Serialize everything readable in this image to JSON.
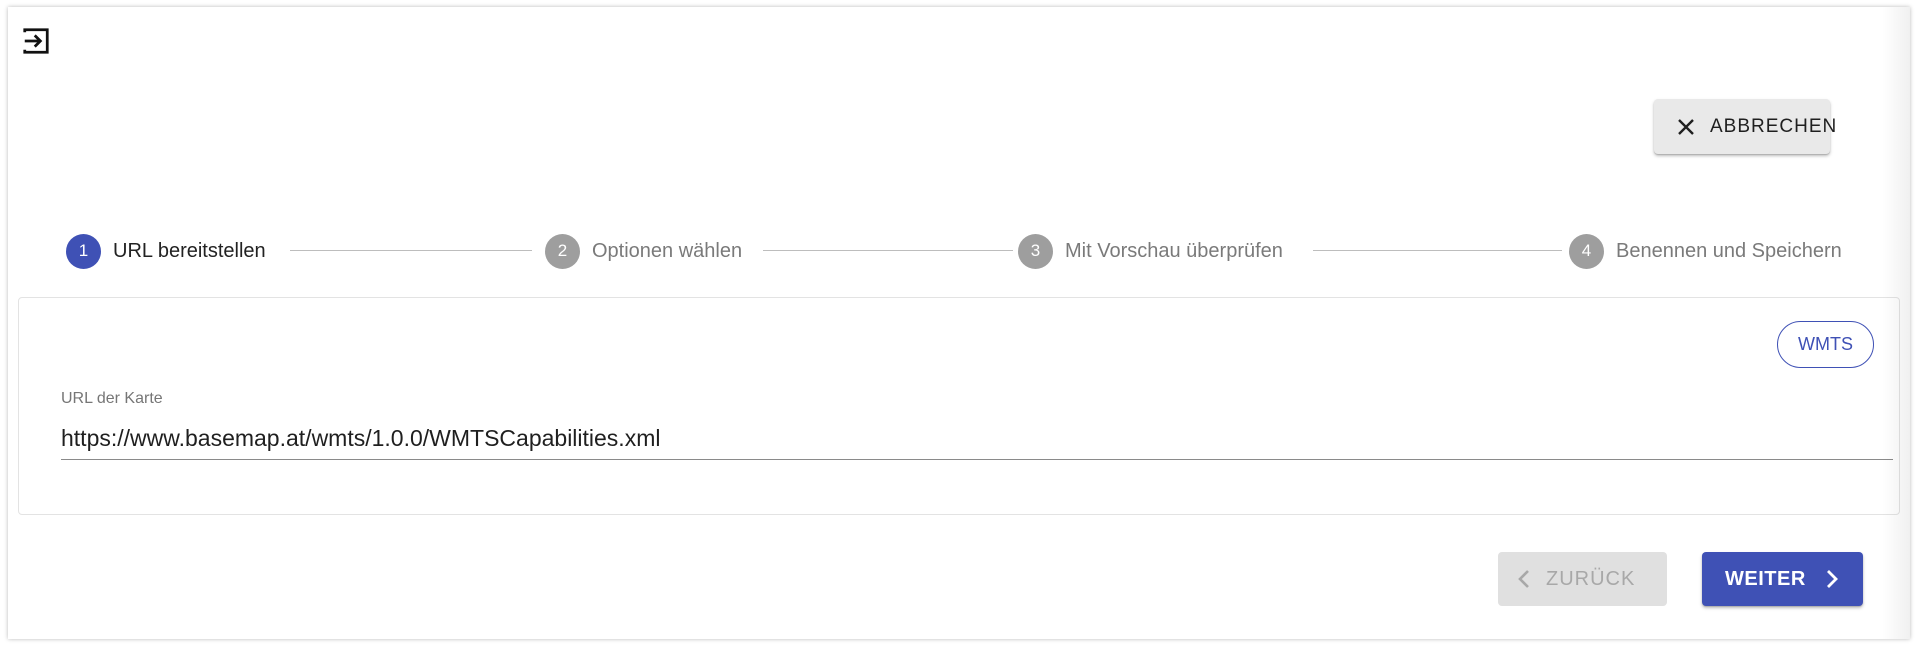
{
  "header": {
    "exit_icon": "exit-to-app-icon",
    "cancel_button": {
      "icon": "close-icon",
      "label": "ABBRECHEN"
    }
  },
  "stepper": {
    "active_step": 1,
    "steps": [
      {
        "number": "1",
        "label": "URL bereitstellen",
        "state": "active"
      },
      {
        "number": "2",
        "label": "Optionen wählen",
        "state": "inactive"
      },
      {
        "number": "3",
        "label": "Mit Vorschau überprüfen",
        "state": "inactive"
      },
      {
        "number": "4",
        "label": "Benennen und Speichern",
        "state": "inactive"
      }
    ]
  },
  "form": {
    "service_chip": "WMTS",
    "url_label": "URL der Karte",
    "url_value": "https://www.basemap.at/wmts/1.0.0/WMTSCapabilities.xml"
  },
  "footer": {
    "back_button": {
      "label": "ZURÜCK",
      "icon": "chevron-left-icon",
      "disabled": true
    },
    "next_button": {
      "label": "WEITER",
      "icon": "chevron-right-icon"
    }
  },
  "colors": {
    "primary": "#3f51b5",
    "inactive_step": "#9e9e9e",
    "disabled_button_bg": "#e0e0e0",
    "cancel_button_bg": "#e9e9e9"
  }
}
